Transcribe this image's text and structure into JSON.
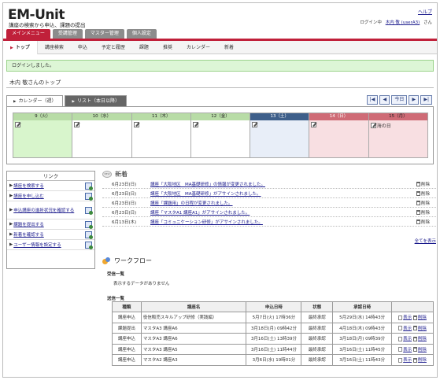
{
  "header": {
    "logo": "EM-Unit",
    "tagline": "講座の検索から申込、課題の提出",
    "help": "ヘルプ",
    "login_label": "ログイン中",
    "user_link": "木内 敬 (userA3)",
    "user_suffix": "さん"
  },
  "tabs": [
    {
      "label": "メインメニュー",
      "active": true
    },
    {
      "label": "受講管理",
      "active": false
    },
    {
      "label": "マスター管理",
      "active": false
    },
    {
      "label": "個人設定",
      "active": false
    }
  ],
  "subnav": [
    {
      "label": "トップ",
      "active": true
    },
    {
      "label": "講座検索"
    },
    {
      "label": "申込"
    },
    {
      "label": "予定と履歴"
    },
    {
      "label": "課題"
    },
    {
      "label": "推奨"
    },
    {
      "label": "カレンダー"
    },
    {
      "label": "新着"
    }
  ],
  "message": "ログインしました。",
  "page_title": "木内 敬さんのトップ",
  "calendar_tabs": [
    {
      "label": "カレンダー（週）",
      "active": true
    },
    {
      "label": "リスト（本日以降）",
      "active": false
    }
  ],
  "calendar_nav": {
    "first": "|◀",
    "prev": "◀",
    "today": "今日",
    "next": "▶",
    "last": "▶|"
  },
  "calendar_days": [
    {
      "label": "9（火）",
      "head_color": "#b8dca6",
      "body_color": "#d8f5cc",
      "holiday": ""
    },
    {
      "label": "10（水）",
      "head_color": "#b8dca6",
      "body_color": "#ffffff",
      "holiday": ""
    },
    {
      "label": "11（木）",
      "head_color": "#b8dca6",
      "body_color": "#ffffff",
      "holiday": ""
    },
    {
      "label": "12（金）",
      "head_color": "#b8dca6",
      "body_color": "#ffffff",
      "holiday": ""
    },
    {
      "label": "13（土）",
      "head_color": "#3e5f8a",
      "body_color": "#e8eef8",
      "holiday": "",
      "head_text": "#ffffff"
    },
    {
      "label": "14（日）",
      "head_color": "#cf6b76",
      "body_color": "#f8dfe2",
      "holiday": "",
      "head_text": "#ffffff"
    },
    {
      "label": "15（月）",
      "head_color": "#cf6b76",
      "body_color": "#f8dfe2",
      "holiday": "海の日",
      "head_text": "#222222"
    }
  ],
  "links": {
    "title": "リンク",
    "items": [
      "講座を検索する",
      "講座を申し込む",
      "申込講座の進捗状況を確認する",
      "課題を提出する",
      "新着を確認する",
      "ユーザー情報を設定する"
    ]
  },
  "news": {
    "title": "新着",
    "delete_label": "削除",
    "show_all": "全てを表示",
    "items": [
      {
        "date": "6月23日(日)",
        "text": "講座「大阪地区　MA基礎研修」の情報が変更されました。"
      },
      {
        "date": "6月23日(日)",
        "text": "講座「大阪地区　MA基礎研修」がアサインされました。"
      },
      {
        "date": "6月23日(日)",
        "text": "講座「課題用」の日程が変更されました。"
      },
      {
        "date": "6月23日(日)",
        "text": "講座「マスタA1 講座A1」がアサインされました。"
      },
      {
        "date": "6月13日(木)",
        "text": "講座「コミュニケーション研修」がアサインされました。"
      }
    ]
  },
  "workflow": {
    "title": "ワークフロー",
    "received_label": "受信一覧",
    "no_data": "表示するデータがありません",
    "sent_label": "送信一覧",
    "columns": [
      "種類",
      "講座名",
      "申込日時",
      "状態",
      "承認日時",
      ""
    ],
    "show_label": "表示",
    "delete_label": "削除",
    "rows": [
      [
        "講座申込",
        "役信販売スキルアップ研修（実践編）",
        "5月7日(火) 17時36分",
        "最終承認",
        "5月29日(水) 14時43分"
      ],
      [
        "課題提出",
        "マスタA3 講座A6",
        "3月18日(月) 09時42分",
        "最終承認",
        "4月18日(木) 09時43分"
      ],
      [
        "講座申込",
        "マスタA3 講座A6",
        "3月16日(土) 13時39分",
        "最終承認",
        "3月18日(月) 09時39分"
      ],
      [
        "講座申込",
        "マスタA3 講座A5",
        "3月16日(土) 11時44分",
        "最終承認",
        "3月16日(土) 11時45分"
      ],
      [
        "講座申込",
        "マスタA2 講座A3",
        "3月6日(水) 19時01分",
        "最終承認",
        "3月16日(土) 11時43分"
      ]
    ]
  }
}
